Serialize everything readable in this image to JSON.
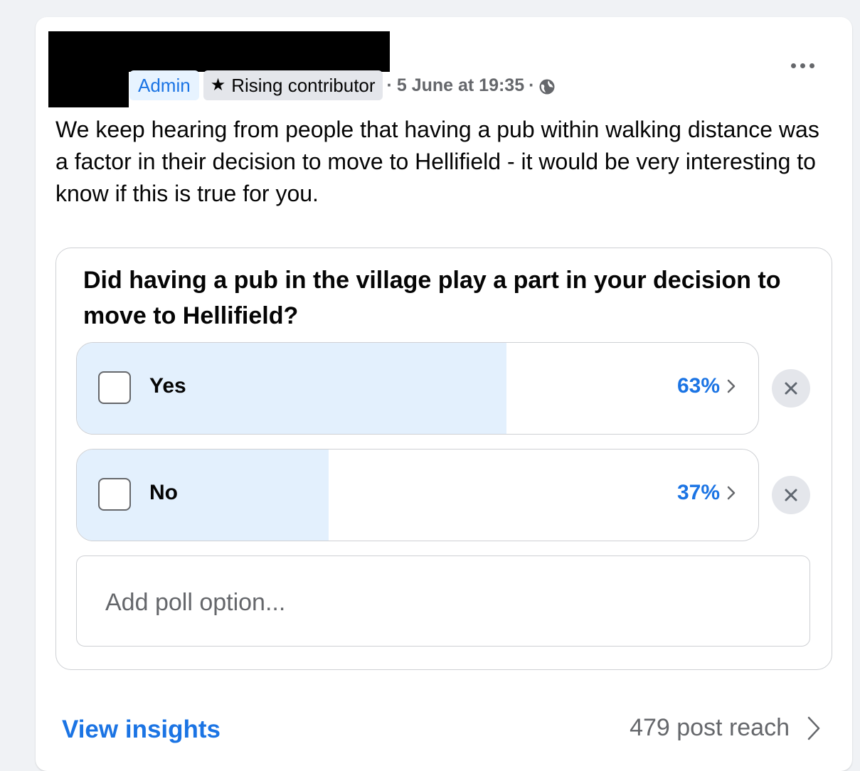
{
  "post": {
    "badges": {
      "admin": "Admin",
      "rising": "Rising contributor"
    },
    "meta_sep_1": "·",
    "timestamp": "5 June at 19:35",
    "meta_sep_2": "·",
    "body": "We keep hearing from people that having a pub within walking distance was a factor in their decision to move to Hellifield - it would be very interesting to know if this is true for you."
  },
  "poll": {
    "question": "Did having a pub in the village play a part in your decision to move to Hellifield?",
    "options": [
      {
        "label": "Yes",
        "percent_text": "63%",
        "percent": 63
      },
      {
        "label": "No",
        "percent_text": "37%",
        "percent": 37
      }
    ],
    "add_option_placeholder": "Add poll option..."
  },
  "footer": {
    "insights_label": "View insights",
    "reach_label": "479 post reach"
  },
  "colors": {
    "accent": "#1b74e4",
    "fill": "#e3f0fd",
    "muted": "#65676b"
  },
  "icons": {
    "more": "more-icon",
    "star": "star-icon",
    "globe": "globe-icon",
    "chevron": "chevron-right-icon",
    "close": "close-icon"
  }
}
